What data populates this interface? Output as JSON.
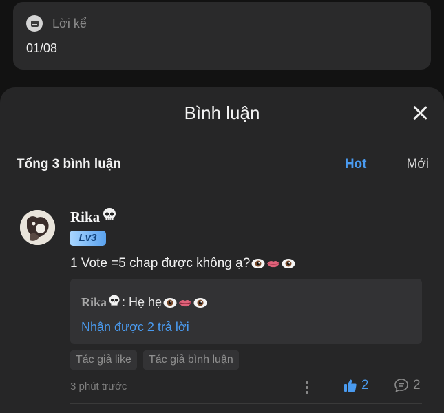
{
  "note": {
    "title": "Lời kể",
    "date": "01/08"
  },
  "sheet": {
    "title": "Bình luận"
  },
  "comments_header": {
    "total": "Tổng 3 bình luận",
    "sort_hot": "Hot",
    "sort_new": "Mới"
  },
  "comment": {
    "username": "Rika",
    "level": "Lv3",
    "text": "1 Vote =5 chap được không ạ?",
    "reply": {
      "username": "Rika",
      "text": ": Hẹ hẹ"
    },
    "reply_more": "Nhận được 2 trả lời",
    "tags": [
      "Tác giả like",
      "Tác giả bình luận"
    ],
    "time": "3 phút trước",
    "likes": "2",
    "replies": "2"
  },
  "colors": {
    "accent": "#4a9bf0",
    "sheet_bg": "#262627",
    "card_bg": "#2a2a2b"
  },
  "icons": [
    "note-icon",
    "close-icon",
    "skull-emoji",
    "eye-emoji",
    "lips-emoji",
    "more-icon",
    "thumbs-up-icon",
    "comment-icon"
  ]
}
